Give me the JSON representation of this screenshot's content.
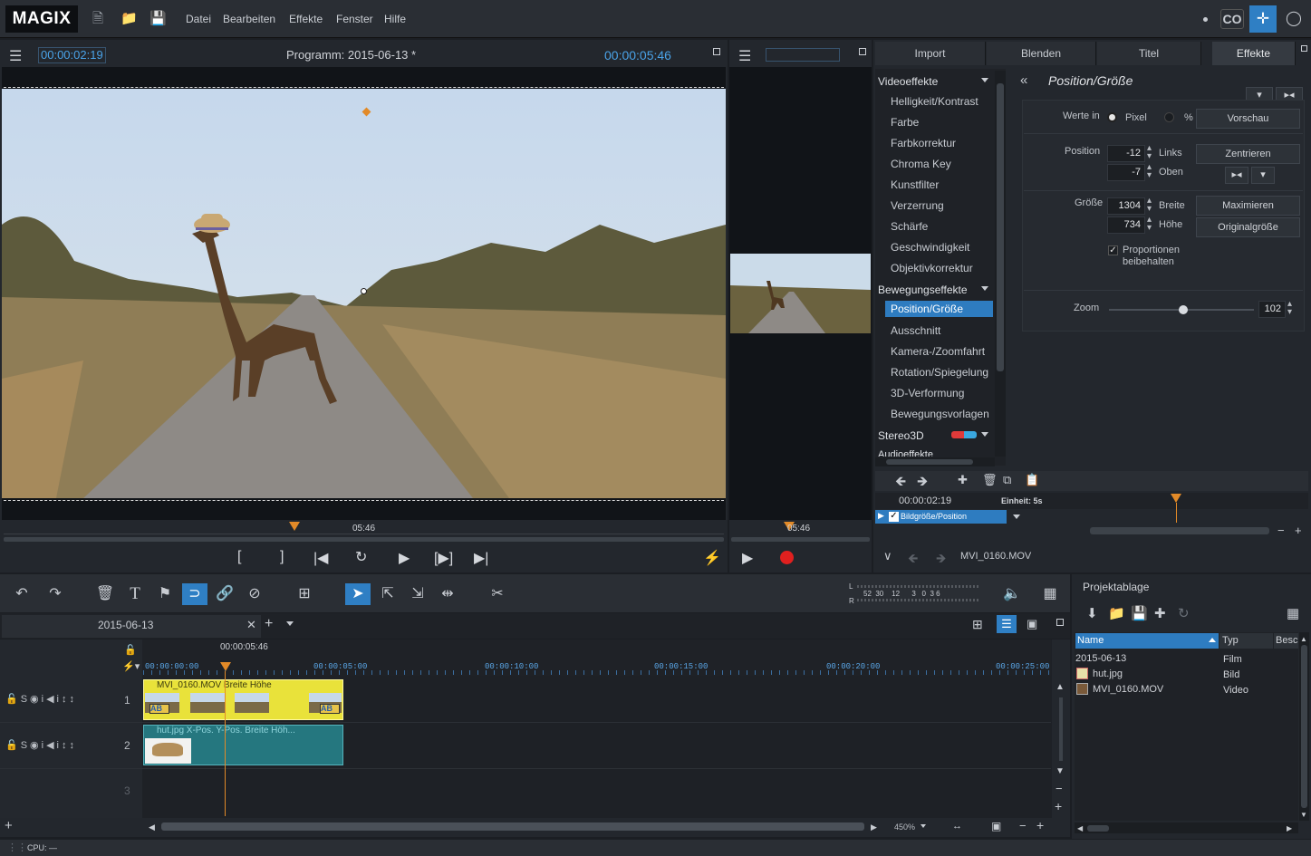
{
  "app": {
    "logo": "MAGIX"
  },
  "menu": [
    "Datei",
    "Bearbeiten",
    "Effekte",
    "Fenster",
    "Hilfe"
  ],
  "program_monitor": {
    "timecode_left": "00:00:02:19",
    "title": "Programm: 2015-06-13 *",
    "timecode_right": "00:00:05:46",
    "marker": "05:46"
  },
  "source_monitor": {
    "marker": "05:46"
  },
  "tabs": [
    "Import",
    "Blenden",
    "Titel",
    "Effekte"
  ],
  "effects": {
    "cat_video": "Videoeffekte",
    "video_items": [
      "Helligkeit/Kontrast",
      "Farbe",
      "Farbkorrektur",
      "Chroma Key",
      "Kunstfilter",
      "Verzerrung",
      "Schärfe",
      "Geschwindigkeit",
      "Objektivkorrektur"
    ],
    "cat_motion": "Bewegungseffekte",
    "motion_items": [
      "Position/Größe",
      "Ausschnitt",
      "Kamera-/Zoomfahrt",
      "Rotation/Spiegelung",
      "3D-Verformung",
      "Bewegungsvorlagen"
    ],
    "cat_stereo": "Stereo3D",
    "cat_audio": "Audioeffekte"
  },
  "params": {
    "title": "Position/Größe",
    "values_in": "Werte in",
    "pixel": "Pixel",
    "percent": "%",
    "preview": "Vorschau",
    "position": "Position",
    "left_val": "-12",
    "left": "Links",
    "top_val": "-7",
    "top": "Oben",
    "center": "Zentrieren",
    "size": "Größe",
    "width_val": "1304",
    "width": "Breite",
    "height_val": "734",
    "height": "Höhe",
    "maximize": "Maximieren",
    "original": "Originalgröße",
    "keep_ratio": "Proportionen beibehalten",
    "zoom": "Zoom",
    "zoom_val": "102"
  },
  "keyframes": {
    "timecode": "00:00:02:19",
    "unit": "Einheit: 5s",
    "track": "Bildgröße/Position"
  },
  "nav": {
    "file": "MVI_0160.MOV"
  },
  "meter": {
    "L": "L",
    "R": "R",
    "scale": [
      "52",
      "30",
      "12",
      "3",
      "0",
      "3",
      "6"
    ]
  },
  "timeline": {
    "tab": "2015-06-13",
    "timecode": "00:00:05:46",
    "ruler": [
      "00:00:00:00",
      "00:00:05:00",
      "00:00:10:00",
      "00:00:15:00",
      "00:00:20:00",
      "00:00:25:00"
    ],
    "tracks": [
      "1",
      "2",
      "3"
    ],
    "clip1": "MVI_0160.MOV  Breite  Höhe",
    "clip2": "hut.jpg  X-Pos.  Y-Pos.  Breite  Höh...",
    "zoom": "450%"
  },
  "project": {
    "title": "Projektablage",
    "cols": [
      "Name",
      "Typ",
      "Besc"
    ],
    "rows": [
      {
        "name": "2015-06-13",
        "type": "Film"
      },
      {
        "name": "hut.jpg",
        "type": "Bild"
      },
      {
        "name": "MVI_0160.MOV",
        "type": "Video"
      }
    ]
  },
  "status": {
    "cpu": "CPU: —"
  }
}
